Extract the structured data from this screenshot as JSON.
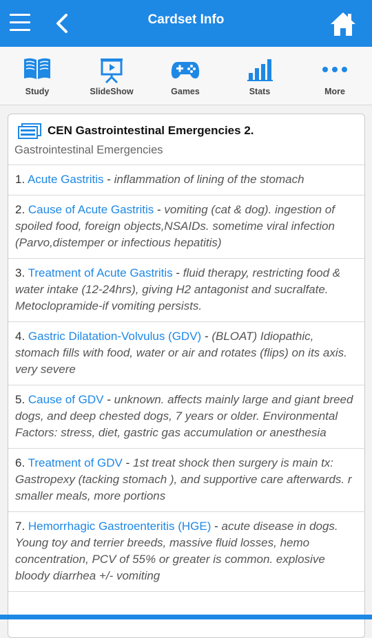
{
  "header": {
    "title": "Cardset Info",
    "menu_icon": "hamburger-icon",
    "back_icon": "chevron-left-icon",
    "home_icon": "home-icon"
  },
  "toolbar": {
    "items": [
      {
        "label": "Study",
        "icon": "book-icon"
      },
      {
        "label": "SlideShow",
        "icon": "slideshow-icon"
      },
      {
        "label": "Games",
        "icon": "gamepad-icon"
      },
      {
        "label": "Stats",
        "icon": "bar-chart-icon"
      },
      {
        "label": "More",
        "icon": "more-dots-icon"
      }
    ]
  },
  "cardset": {
    "title": "CEN Gastrointestinal Emergencies 2.",
    "subtitle": "Gastrointestinal Emergencies",
    "items": [
      {
        "num": "1. ",
        "term": "Acute Gastritis",
        "sep": " - ",
        "def": "inflammation of lining of the stomach"
      },
      {
        "num": "2. ",
        "term": "Cause of Acute Gastritis",
        "sep": " - ",
        "def": "vomiting (cat & dog). ingestion of spoiled food, foreign objects,NSAIDs. sometime viral infection (Parvo,distemper or infectious hepatitis)"
      },
      {
        "num": "3. ",
        "term": "Treatment of Acute Gastritis",
        "sep": " - ",
        "def": "fluid therapy, restricting food & water intake (12-24hrs), giving H2 antagonist and sucralfate. Metoclopramide-if vomiting persists."
      },
      {
        "num": "4. ",
        "term": "Gastric Dilatation-Volvulus (GDV)",
        "sep": " - ",
        "def": "(BLOAT) Idiopathic, stomach fills with food, water or air and rotates (flips) on its axis. very severe"
      },
      {
        "num": "5. ",
        "term": "Cause of GDV",
        "sep": " - ",
        "def": "unknown. affects mainly large and giant breed dogs, and deep chested dogs, 7 years or older. Environmental Factors: stress, diet, gastric gas accumulation or anesthesia"
      },
      {
        "num": "6. ",
        "term": "Treatment of GDV",
        "sep": " - ",
        "def": "1st treat shock then surgery is main tx: Gastropexy (tacking stomach ), and supportive care afterwards. r smaller meals, more portions"
      },
      {
        "num": "7. ",
        "term": "Hemorrhagic Gastroenteritis (HGE)",
        "sep": " - ",
        "def": "acute disease in dogs. Young toy and terrier breeds, massive fluid losses, hemo concentration, PCV of 55% or greater is common. explosive bloody diarrhea +/- vomiting"
      }
    ]
  },
  "colors": {
    "primary": "#1e88e5",
    "link": "#1e88e5"
  }
}
